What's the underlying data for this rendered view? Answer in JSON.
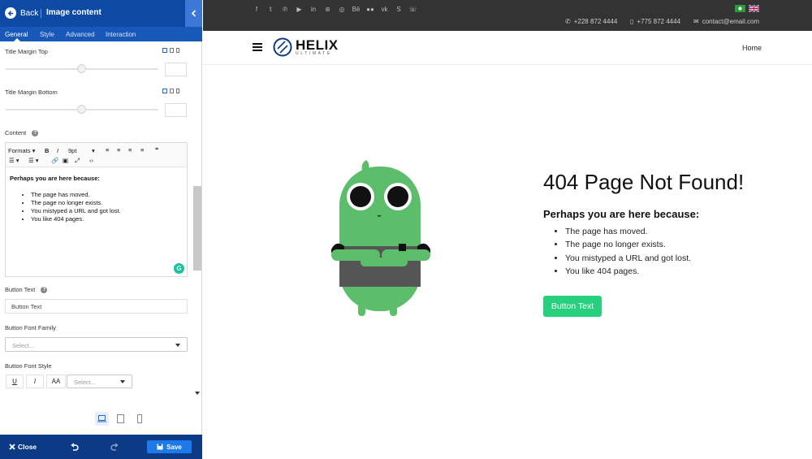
{
  "panel": {
    "header": {
      "back_label": "Back",
      "title": "Image content"
    },
    "tabs": [
      {
        "label": "General",
        "active": true
      },
      {
        "label": "Style",
        "active": false
      },
      {
        "label": "Advanced",
        "active": false
      },
      {
        "label": "Interaction",
        "active": false
      }
    ],
    "fields": {
      "title_margin_top": {
        "label": "Title Margin Top",
        "value": ""
      },
      "title_margin_bottom": {
        "label": "Title Margin Bottom",
        "value": ""
      },
      "content": {
        "label": "Content",
        "toolbar": {
          "formats": "Formats",
          "font_size": "9pt"
        },
        "heading": "Perhaps you are here because:",
        "items": [
          "The page has moved.",
          "The page no longer exists.",
          "You mistyped a URL and got lost.",
          "You like 404 pages."
        ]
      },
      "button_text": {
        "label": "Button Text",
        "value": "Button Text"
      },
      "button_font_family": {
        "label": "Button Font Family",
        "placeholder": "Select..."
      },
      "button_font_style": {
        "label": "Button Font Style",
        "underline": "U",
        "italic": "I",
        "uppercase": "AA",
        "weight_placeholder": "Select..."
      }
    },
    "footer": {
      "close_label": "Close",
      "save_label": "Save"
    }
  },
  "preview": {
    "topbar": {
      "socials": [
        "facebook-icon",
        "twitter-icon",
        "pinterest-icon",
        "youtube-icon",
        "linkedin-icon",
        "dribbble-icon",
        "instagram-icon",
        "behance-icon",
        "flickr-icon",
        "vk-icon",
        "skype-icon",
        "whatsapp-icon"
      ],
      "phone": "+228 872 4444",
      "mobile": "+775 872 4444",
      "email": "contact@email.com"
    },
    "navbar": {
      "logo_main": "HELIX",
      "logo_sub": "ULTIMATE",
      "home": "Home"
    },
    "error": {
      "title": "404 Page Not Found!",
      "subtitle": "Perhaps you are here because:",
      "items": [
        "The page has moved.",
        "The page no longer exists.",
        "You mistyped a URL and got lost.",
        "You like 404 pages."
      ],
      "button": "Button Text"
    }
  },
  "colors": {
    "panel_blue": "#0c4aa6",
    "button_green": "#26d07c",
    "mascot_green": "#5cbd6a",
    "topbar": "#333333"
  }
}
